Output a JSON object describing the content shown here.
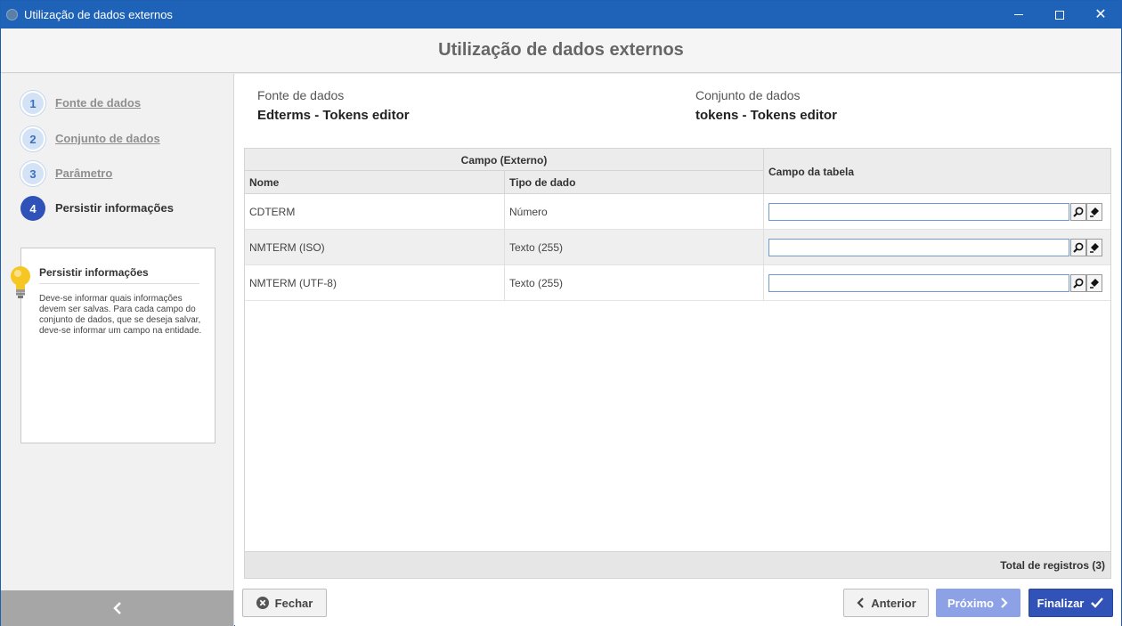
{
  "window": {
    "title": "Utilização de dados externos"
  },
  "header": {
    "title": "Utilização de dados externos"
  },
  "steps": [
    {
      "number": "1",
      "label": "Fonte de dados"
    },
    {
      "number": "2",
      "label": "Conjunto de dados"
    },
    {
      "number": "3",
      "label": "Parâmetro"
    },
    {
      "number": "4",
      "label": "Persistir informações"
    }
  ],
  "tip": {
    "title": "Persistir informações",
    "text": "Deve-se informar quais informações devem ser salvas. Para cada campo do conjunto de dados, que se deseja salvar, deve-se informar um campo na entidade."
  },
  "info": {
    "source_label": "Fonte de dados",
    "source_value": "Edterms - Tokens editor",
    "dataset_label": "Conjunto de dados",
    "dataset_value": "tokens - Tokens editor"
  },
  "grid": {
    "group_header": "Campo (Externo)",
    "col_nome": "Nome",
    "col_tipo": "Tipo de dado",
    "col_campo": "Campo da tabela",
    "rows": [
      {
        "nome": "CDTERM",
        "tipo": "Número",
        "campo": ""
      },
      {
        "nome": "NMTERM (ISO)",
        "tipo": "Texto (255)",
        "campo": ""
      },
      {
        "nome": "NMTERM (UTF-8)",
        "tipo": "Texto (255)",
        "campo": ""
      }
    ],
    "total": "Total de registros (3)"
  },
  "buttons": {
    "fechar": "Fechar",
    "anterior": "Anterior",
    "proximo": "Próximo",
    "finalizar": "Finalizar"
  },
  "colors": {
    "titlebar": "#1f63b8",
    "active_step": "#2f52b8",
    "primary_button": "#3152b6",
    "disabled_button": "#8da2e6"
  }
}
